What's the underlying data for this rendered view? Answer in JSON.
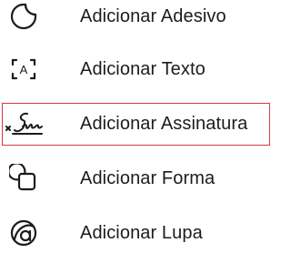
{
  "menu": {
    "items": [
      {
        "id": "sticker",
        "label": "Adicionar Adesivo",
        "icon": "sticker-icon"
      },
      {
        "id": "text",
        "label": "Adicionar Texto",
        "icon": "text-box-icon",
        "icon_glyph": "A"
      },
      {
        "id": "signature",
        "label": "Adicionar Assinatura",
        "icon": "signature-icon",
        "highlighted": true
      },
      {
        "id": "shape",
        "label": "Adicionar Forma",
        "icon": "shapes-icon"
      },
      {
        "id": "magnifier",
        "label": "Adicionar Lupa",
        "icon": "magnifier-icon"
      }
    ]
  },
  "colors": {
    "text": "#1c1c1e",
    "highlight_border": "#d43a43",
    "background": "#ffffff"
  }
}
